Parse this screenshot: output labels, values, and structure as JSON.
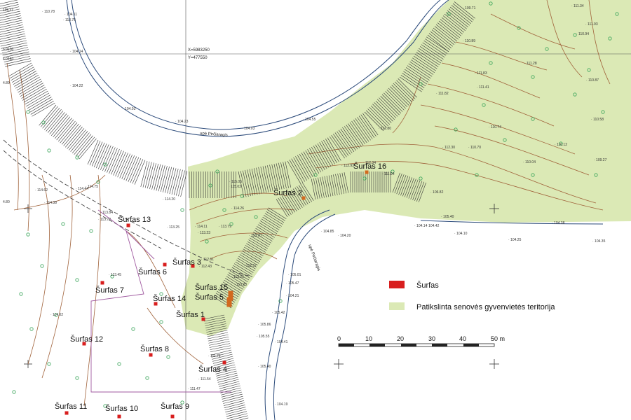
{
  "map": {
    "coordinate_labels": [
      "X=5983250",
      "Y=477550"
    ],
    "river_labels": [
      "upė Pirčiaragis",
      "upė Pirčiaragis"
    ],
    "side_labels": [
      "6.0130",
      "6.0150",
      "5.73",
      "4.89",
      "4.80",
      "115.37"
    ],
    "surfas_points": [
      {
        "label": "Šurfas 13"
      },
      {
        "label": "Šurfas 6"
      },
      {
        "label": "Šurfas 7"
      },
      {
        "label": "Šurfas 3"
      },
      {
        "label": "Šurfas 14"
      },
      {
        "label": "Šurfas 15"
      },
      {
        "label": "Šurfas 5"
      },
      {
        "label": "Šurfas 1"
      },
      {
        "label": "Šurfas 12"
      },
      {
        "label": "Šurfas 8"
      },
      {
        "label": "Šurfas 4"
      },
      {
        "label": "Šurfas 11"
      },
      {
        "label": "Šurfas 10"
      },
      {
        "label": "Šurfas 9"
      },
      {
        "label": "Šurfas 2"
      },
      {
        "label": "Šurfas 16"
      }
    ],
    "elevations": [
      "110.78",
      "104.11",
      "113.75",
      "104.14",
      "104.22",
      "104.03",
      "104.23",
      "104.55",
      "104.03",
      "109.71",
      "111.34",
      "111.93",
      "110.94",
      "110.89",
      "111.28",
      "110.87",
      "111.83",
      "111.41",
      "111.82",
      "112.30",
      "110.70",
      "110.74",
      "110.12",
      "110.58",
      "109.27",
      "110.04",
      "112.93",
      "112.34",
      "111.94",
      "106.82",
      "105.40",
      "104.85",
      "104.42",
      "104.10",
      "104.20",
      "104.14",
      "104.25",
      "104.38",
      "104.35",
      "113.84",
      "113.72",
      "114.20",
      "113.25",
      "114.75",
      "114.44",
      "114.62",
      "114.38",
      "113.23",
      "114.11",
      "113.79",
      "114.26",
      "113.70",
      "112.57",
      "113.25",
      "112.61",
      "112.43",
      "113.45",
      "114.02",
      "111.47",
      "111.54",
      "105.40",
      "104.19",
      "105.47",
      "105.01",
      "104.21",
      "104.41",
      "105.42",
      "105.55",
      "105.86",
      "111.72",
      "112.80",
      "113.25",
      "115.05",
      "115.02"
    ]
  },
  "legend": {
    "items": [
      {
        "label": "Šurfas",
        "color": "#d81e1e"
      },
      {
        "label": "Patikslinta senovės gyvenvietės teritorija",
        "color": "#dbe9b5"
      }
    ]
  },
  "scale_bar": {
    "ticks": [
      "0",
      "10",
      "20",
      "30",
      "40",
      "50 m"
    ]
  },
  "colors": {
    "terrace_fill": "#dbe9b5",
    "contour": "#a0623a",
    "river": "#2b4a7a",
    "hatch": "#333333",
    "marker": "#d81e1e",
    "green_point": "#3aa55a",
    "purple_line": "#a05aa0"
  }
}
